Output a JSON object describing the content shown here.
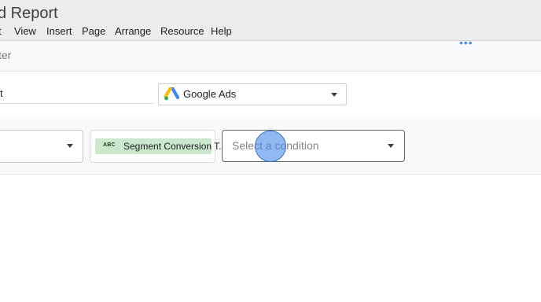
{
  "window": {
    "title": "d Report"
  },
  "menu": [
    "t",
    "View",
    "Insert",
    "Page",
    "Arrange",
    "Resource",
    "Help"
  ],
  "filter_bar": {
    "text": "ter",
    "more_icon": "more-horiz-icon"
  },
  "filter_name": {
    "value": "t"
  },
  "data_source": {
    "label": "Google Ads",
    "icon": "google-ads-icon"
  },
  "condition_row": {
    "field_value": "",
    "dimension": {
      "type_badge": "ABC",
      "label": "Segment Conversion T..."
    },
    "condition": {
      "placeholder": "Select a condition"
    }
  },
  "colors": {
    "chip_bg": "#cbe8cd",
    "accent": "#4f8fe6",
    "click": "#4a89e8"
  }
}
